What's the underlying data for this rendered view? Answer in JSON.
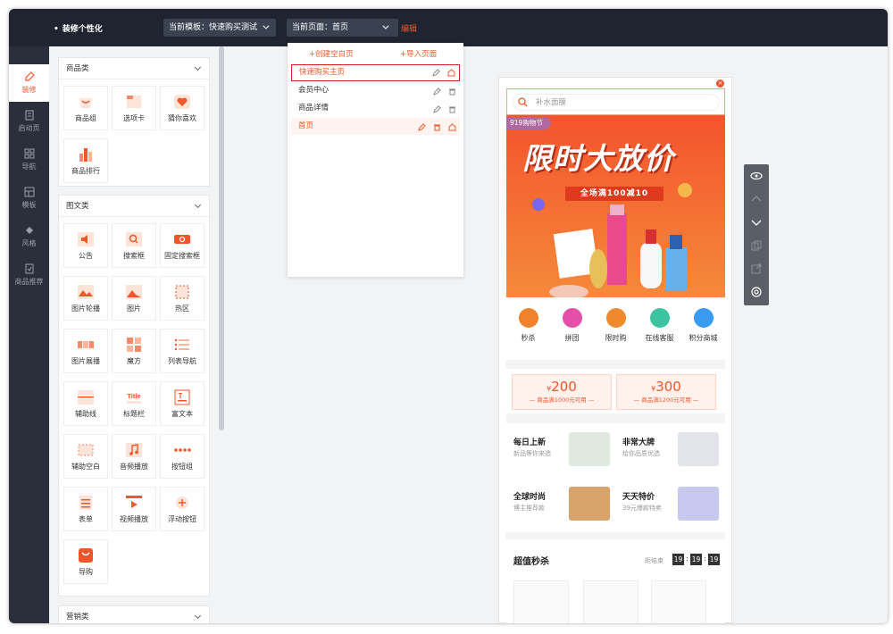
{
  "header": {
    "brand": "装修个性化",
    "template_selector": "当前模板：快速购买测试",
    "page_selector": "当前页面：首页",
    "edit_label": "编辑"
  },
  "sidebar": {
    "items": [
      {
        "label": "装修",
        "icon": "brush-icon"
      },
      {
        "label": "启动页",
        "icon": "document-icon"
      },
      {
        "label": "导航",
        "icon": "grid-icon"
      },
      {
        "label": "模板",
        "icon": "template-icon"
      },
      {
        "label": "风格",
        "icon": "palette-icon"
      },
      {
        "label": "商品推荐",
        "icon": "recommend-icon"
      }
    ]
  },
  "panel": {
    "groups": [
      {
        "title": "商品类",
        "items": [
          "商品组",
          "选项卡",
          "猜你喜欢",
          "商品排行"
        ]
      },
      {
        "title": "图文类",
        "items": [
          "公告",
          "搜索框",
          "固定搜索框",
          "图片轮播",
          "图片",
          "热区",
          "图片展播",
          "魔方",
          "列表导航",
          "辅助线",
          "标题栏",
          "富文本",
          "辅助空白",
          "音频播放",
          "按钮组",
          "表单",
          "视频播放",
          "浮动按钮",
          "导购"
        ]
      },
      {
        "title": "营销类",
        "items": []
      }
    ],
    "title_tile_text": "Title",
    "richtext_tile_text": "T"
  },
  "page_menu": {
    "create_blank": "+创建空白页",
    "import_page": "+导入页面",
    "pages": [
      {
        "name": "快速购买主页",
        "state": "selected"
      },
      {
        "name": "会员中心",
        "state": "normal"
      },
      {
        "name": "商品详情",
        "state": "normal"
      },
      {
        "name": "首页",
        "state": "current"
      }
    ]
  },
  "preview": {
    "search_placeholder": "补水面膜",
    "close": "×",
    "banner": {
      "tag": "919购物节",
      "headline": "限时大放价",
      "subline": "全场满100减10"
    },
    "quick_icons": [
      {
        "label": "秒杀",
        "color": "#f0822e"
      },
      {
        "label": "拼团",
        "color": "#e64fa8"
      },
      {
        "label": "限时购",
        "color": "#f0892e"
      },
      {
        "label": "在线客服",
        "color": "#3cc4a0"
      },
      {
        "label": "积分商城",
        "color": "#3a9bf0"
      }
    ],
    "coupons": [
      {
        "currency": "¥",
        "amount": "200",
        "condition": "— 商品满1000元可用 —"
      },
      {
        "currency": "¥",
        "amount": "300",
        "condition": "— 商品满1200元可用 —"
      }
    ],
    "promos": [
      {
        "title": "每日上新",
        "subtitle": "新品等你来选",
        "color": "#dfe9df"
      },
      {
        "title": "非常大牌",
        "subtitle": "给你品质优选",
        "color": "#e3e3ea"
      },
      {
        "title": "全球时尚",
        "subtitle": "博主推荐款",
        "color": "#d8a46c"
      },
      {
        "title": "天天特价",
        "subtitle": "39元爆款特卖",
        "color": "#c9c9f0"
      }
    ],
    "seckill": {
      "title": "超值秒杀",
      "countdown_label": "距结束",
      "hours": "19",
      "minutes": "19",
      "seconds": "19",
      "colon": ":"
    }
  },
  "colors": {
    "accent": "#f1562b",
    "topbar": "#1f2430",
    "sidebar": "#2a2f3b"
  }
}
